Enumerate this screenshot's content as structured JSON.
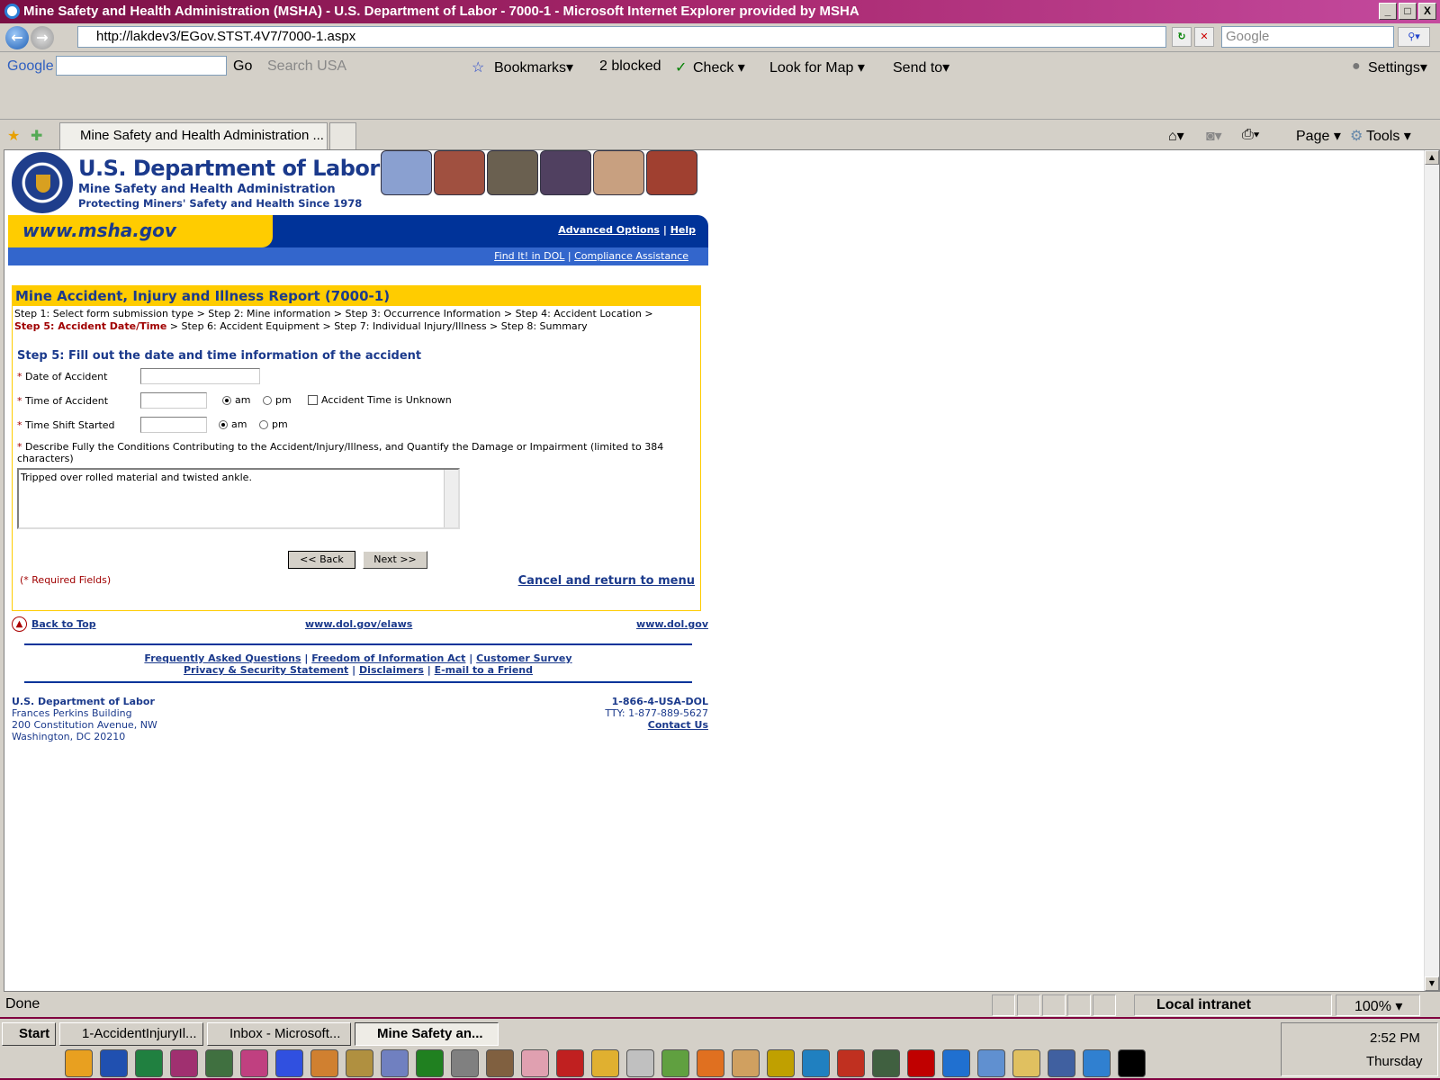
{
  "window": {
    "title": "Mine Safety and Health Administration (MSHA) - U.S. Department of Labor - 7000-1 - Microsoft Internet Explorer provided by MSHA",
    "buttons": [
      "_",
      "□",
      "X"
    ]
  },
  "address_bar": {
    "url": "http://lakdev3/EGov.STST.4V7/7000-1.aspx",
    "search_placeholder": "Google"
  },
  "google_toolbar": {
    "logo": "Google",
    "go": "Go",
    "search_usa": "Search USA",
    "bookmarks": "Bookmarks▾",
    "blocked": "2 blocked",
    "check": "Check ▾",
    "look_for_map": "Look for Map ▾",
    "send_to": "Send to▾",
    "settings": "Settings▾"
  },
  "tabs": {
    "active": "Mine Safety and Health Administration ..."
  },
  "command_bar": {
    "page": "Page ▾",
    "tools": "Tools ▾"
  },
  "header": {
    "org": "U.S. Department of Labor",
    "agency": "Mine Safety and Health Administration",
    "tagline": "Protecting Miners' Safety and Health Since 1978",
    "site": "www.msha.gov",
    "advanced": "Advanced Options",
    "help": "Help",
    "find_it": "Find It! in DOL",
    "compliance": "Compliance Assistance",
    "sep": "|"
  },
  "form": {
    "title": "Mine Accident, Injury and Illness Report (7000-1)",
    "steps": [
      "Step 1: Select form submission type",
      "Step 2: Mine information",
      "Step 3: Occurrence Information",
      "Step 4: Accident Location",
      "Step 5: Accident Date/Time",
      "Step 6: Accident Equipment",
      "Step 7: Individual Injury/Illness",
      "Step 8: Summary"
    ],
    "step_sep": " > ",
    "heading": "Step 5: Fill out the date and time information of the accident",
    "star": "*",
    "date_label": "Date of Accident",
    "date_value": "",
    "time_label": "Time of Accident",
    "time_value": "",
    "time_ampm": "am",
    "am": "am",
    "pm": "pm",
    "unknown_label": "Accident Time is Unknown",
    "unknown_checked": false,
    "shift_label": "Time Shift Started",
    "shift_value": "",
    "shift_ampm": "am",
    "describe_label": "Describe Fully the Conditions Contributing to the Accident/Injury/Illness, and Quantify the Damage or Impairment (limited to 384 characters)",
    "describe_value": "Tripped over rolled material and twisted ankle.",
    "back": "<< Back",
    "next": "Next >>",
    "required": "(* Required Fields)",
    "cancel": "Cancel and return to menu"
  },
  "footer": {
    "back_to_top": "Back to Top",
    "elaws": "www.dol.gov/elaws",
    "dol": "www.dol.gov",
    "links1": [
      "Frequently Asked Questions",
      "Freedom of Information Act",
      "Customer Survey"
    ],
    "links2": [
      "Privacy & Security Statement",
      "Disclaimers",
      "E-mail to a Friend"
    ],
    "address": [
      "U.S. Department of Labor",
      "Frances Perkins Building",
      "200 Constitution Avenue, NW",
      "Washington, DC 20210"
    ],
    "phone": "1-866-4-USA-DOL",
    "tty": "TTY: 1-877-889-5627",
    "contact": "Contact Us"
  },
  "status_bar": {
    "text": "Done",
    "zone": "Local intranet",
    "zoom": "100%"
  },
  "taskbar": {
    "start": "Start",
    "items": [
      "1-AccidentInjuryIl...",
      "Inbox - Microsoft...",
      "Mine Safety an..."
    ],
    "time": "2:52 PM",
    "day": "Thursday",
    "quicklaunch_icons": [
      "outlook-icon",
      "word-icon",
      "excel-icon",
      "powerpoint-icon",
      "project-icon",
      "pinwheel-icon",
      "marge-icon",
      "duck-icon",
      "moneybag-icon",
      "bird-icon",
      "sprite-icon",
      "diamond-icon",
      "bug-icon",
      "pinky-icon",
      "mouse-icon",
      "giraffe-icon",
      "cat-icon",
      "gremlin-icon",
      "tiger-icon",
      "search-folder-icon",
      "gadget-icon",
      "sync-icon",
      "woody-icon",
      "daffy-icon",
      "acrobat-icon",
      "ie-icon",
      "notepad-icon",
      "explorer-search-icon",
      "calc-icon",
      "note-icon",
      "cmd-icon"
    ]
  },
  "colors": {
    "dol_blue": "#1b3a8c",
    "bar_blue": "#003399",
    "gold": "#ffcc00",
    "current_step": "#a00000"
  }
}
